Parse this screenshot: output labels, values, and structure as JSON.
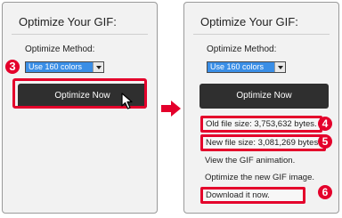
{
  "left_panel": {
    "title": "Optimize Your GIF:",
    "method_label": "Optimize Method:",
    "method_selected": "Use 160 colors",
    "optimize_button": "Optimize Now",
    "step_badge": "3"
  },
  "right_panel": {
    "title": "Optimize Your GIF:",
    "method_label": "Optimize Method:",
    "method_selected": "Use 160 colors",
    "optimize_button": "Optimize Now",
    "old_size": "Old file size: 3,753,632 bytes.",
    "new_size": "New file size: 3,081,269 bytes.",
    "view_animation": "View the GIF animation.",
    "optimize_new": "Optimize the new GIF image.",
    "download": "Download it now.",
    "badges": [
      "4",
      "5",
      "6"
    ]
  },
  "colors": {
    "highlight": "#e4002b",
    "button": "#2f2f2f",
    "select_highlight": "#3a8ee6"
  },
  "icons": [
    "mouse-cursor-icon",
    "right-arrow-icon",
    "dropdown-arrow-icon"
  ]
}
